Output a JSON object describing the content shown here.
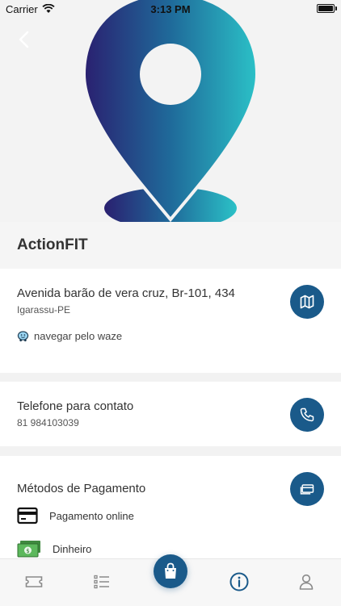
{
  "status_bar": {
    "carrier": "Carrier",
    "time": "3:13 PM"
  },
  "gym": {
    "name": "ActionFIT"
  },
  "address": {
    "line": "Avenida barão de vera cruz, Br-101, 434",
    "city": "Igarassu-PE",
    "waze_label": "navegar pelo waze"
  },
  "contact": {
    "label": "Telefone para contato",
    "phone": "81 984103039"
  },
  "payment": {
    "title": "Métodos de Pagamento",
    "methods": [
      {
        "label": "Pagamento online",
        "icon": "credit-card-icon"
      },
      {
        "label": "Dinheiro",
        "icon": "cash-icon"
      }
    ]
  },
  "tabs": [
    "ticket-icon",
    "list-icon",
    "shopping-bag-icon",
    "info-icon",
    "user-icon"
  ],
  "colors": {
    "accent": "#1a5a8a",
    "pin_start": "#2a2a7a",
    "pin_end": "#2bbfc6"
  }
}
